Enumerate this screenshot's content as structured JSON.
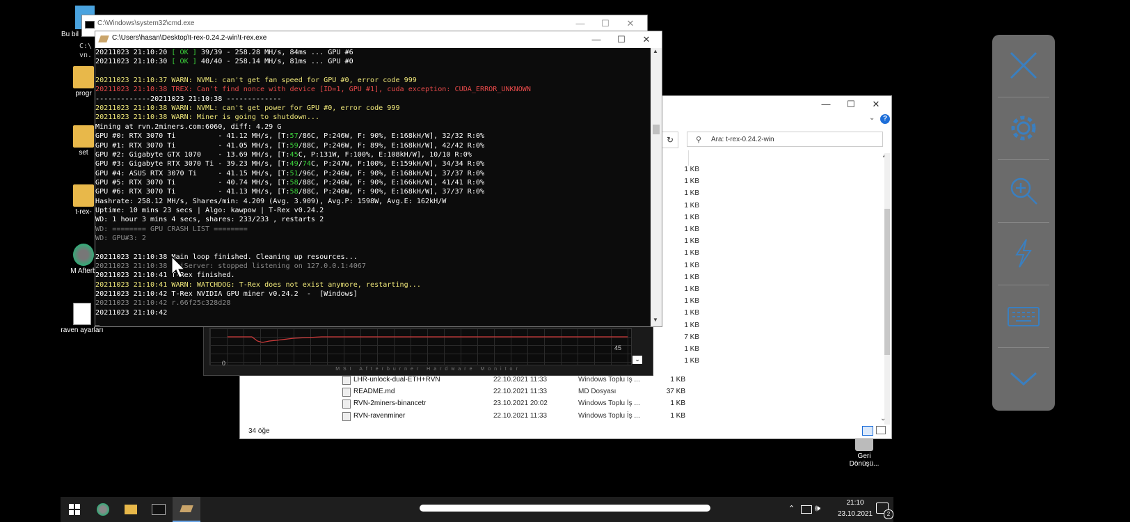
{
  "desktop": {
    "icons": [
      {
        "label": "Bu bil"
      },
      {
        "label": "progr"
      },
      {
        "label": "set"
      },
      {
        "label": "t-rex-"
      },
      {
        "label": "M Afterb"
      },
      {
        "label": "raven ayarları"
      },
      {
        "label": "Geri Dönüşü..."
      }
    ]
  },
  "cmd_window": {
    "title": "C:\\Windows\\system32\\cmd.exe",
    "partial_text": "C:\\ vn."
  },
  "trex_window": {
    "title": "C:\\Users\\hasan\\Desktop\\t-rex-0.24.2-win\\t-rex.exe",
    "lines": [
      [
        {
          "t": "20211023 21:10:20 ",
          "c": "w"
        },
        {
          "t": "[ OK ]",
          "c": "g"
        },
        {
          "t": " 39/39 - 258.28 MH/s, 84ms ... GPU #6",
          "c": "w"
        }
      ],
      [
        {
          "t": "20211023 21:10:30 ",
          "c": "w"
        },
        {
          "t": "[ OK ]",
          "c": "g"
        },
        {
          "t": " 40/40 - 258.14 MH/s, 81ms ... GPU #0",
          "c": "w"
        }
      ],
      [],
      [
        {
          "t": "20211023 21:10:37 WARN: NVML: can't get fan speed for GPU #0, error code 999",
          "c": "y"
        }
      ],
      [
        {
          "t": "20211023 21:10:38 TREX: Can't find nonce with device [ID=1, GPU #1], cuda exception: CUDA_ERROR_UNKNOWN",
          "c": "r"
        }
      ],
      [
        {
          "t": "-------------20211023 21:10:38 -------------",
          "c": "w"
        }
      ],
      [
        {
          "t": "20211023 21:10:38 WARN: NVML: can't get power for GPU #0, error code 999",
          "c": "y"
        }
      ],
      [
        {
          "t": "20211023 21:10:38 WARN: Miner is going to shutdown...",
          "c": "y"
        }
      ],
      [
        {
          "t": "Mining at rvn.2miners.com:6060, diff: 4.29 G",
          "c": "w"
        }
      ],
      [
        {
          "t": "GPU #0: RTX 3070 Ti          - 41.12 MH/s, [T:",
          "c": "w"
        },
        {
          "t": "57",
          "c": "g"
        },
        {
          "t": "/86C, P:246W, F: 90%, E:168kH/W], 32/32 R:0%",
          "c": "w"
        }
      ],
      [
        {
          "t": "GPU #1: RTX 3070 Ti          - 41.05 MH/s, [T:",
          "c": "w"
        },
        {
          "t": "59",
          "c": "g"
        },
        {
          "t": "/88C, P:246W, F: 89%, E:168kH/W], 42/42 R:0%",
          "c": "w"
        }
      ],
      [
        {
          "t": "GPU #2: Gigabyte GTX 1070    - 13.69 MH/s, [T:",
          "c": "w"
        },
        {
          "t": "45",
          "c": "g"
        },
        {
          "t": "C, P:131W, F:100%, E:108kH/W], 10/10 R:0%",
          "c": "w"
        }
      ],
      [
        {
          "t": "GPU #3: Gigabyte RTX 3070 Ti - 39.23 MH/s, [T:",
          "c": "w"
        },
        {
          "t": "49",
          "c": "g"
        },
        {
          "t": "/",
          "c": "w"
        },
        {
          "t": "74",
          "c": "g"
        },
        {
          "t": "C, P:247W, F:100%, E:159kH/W], 34/34 R:0%",
          "c": "w"
        }
      ],
      [
        {
          "t": "GPU #4: ASUS RTX 3070 Ti     - 41.15 MH/s, [T:",
          "c": "w"
        },
        {
          "t": "51",
          "c": "g"
        },
        {
          "t": "/96C, P:246W, F: 90%, E:168kH/W], 37/37 R:0%",
          "c": "w"
        }
      ],
      [
        {
          "t": "GPU #5: RTX 3070 Ti          - 40.74 MH/s, [T:",
          "c": "w"
        },
        {
          "t": "58",
          "c": "g"
        },
        {
          "t": "/88C, P:246W, F: 90%, E:166kH/W], 41/41 R:0%",
          "c": "w"
        }
      ],
      [
        {
          "t": "GPU #6: RTX 3070 Ti          - 41.13 MH/s, [T:",
          "c": "w"
        },
        {
          "t": "58",
          "c": "g"
        },
        {
          "t": "/88C, P:246W, F: 90%, E:168kH/W], 37/37 R:0%",
          "c": "w"
        }
      ],
      [
        {
          "t": "Hashrate: 258.12 MH/s, Shares/min: 4.209 (Avg. 3.909), Avg.P: 1598W, Avg.E: 162kH/W",
          "c": "w"
        }
      ],
      [
        {
          "t": "Uptime: 10 mins 23 secs | Algo: kawpow | T-Rex v0.24.2",
          "c": "w"
        }
      ],
      [
        {
          "t": "WD: 1 hour 3 mins 4 secs, shares: 233/233 , restarts 2",
          "c": "w"
        }
      ],
      [
        {
          "t": "WD: ======== GPU CRASH LIST ========",
          "c": "gr"
        }
      ],
      [
        {
          "t": "WD: GPU#3: 2",
          "c": "gr"
        }
      ],
      [],
      [
        {
          "t": "20211023 21:10:38 Main loop finished. Cleaning up resources...",
          "c": "w"
        }
      ],
      [
        {
          "t": "20211023 21:10:38 ApiServer: stopped listening on 127.0.0.1:4067",
          "c": "gr"
        }
      ],
      [
        {
          "t": "20211023 21:10:41 T-Rex finished.",
          "c": "w"
        }
      ],
      [
        {
          "t": "20211023 21:10:41 WARN: WATCHDOG: T-Rex does not exist anymore, restarting...",
          "c": "y"
        }
      ],
      [
        {
          "t": "20211023 21:10:42 T-Rex NVIDIA GPU miner v0.24.2  -  [Windows]",
          "c": "w"
        }
      ],
      [
        {
          "t": "20211023 21:10:42 r.66f25c328d28",
          "c": "gr"
        }
      ],
      [
        {
          "t": "20211023 21:10:42",
          "c": "w"
        }
      ],
      [
        {
          "t": "_",
          "c": "w"
        }
      ]
    ]
  },
  "explorer": {
    "search_placeholder": "Ara: t-rex-0.24.2-win",
    "column_fragment": "t",
    "size_column": [
      "1 KB",
      "1 KB",
      "1 KB",
      "1 KB",
      "1 KB",
      "1 KB",
      "1 KB",
      "1 KB",
      "1 KB",
      "1 KB",
      "1 KB",
      "1 KB",
      "1 KB",
      "1 KB",
      "7 KB",
      "1 KB",
      "1 KB"
    ],
    "files": [
      {
        "name": "LHR-unlock-dual-ETH+RVN",
        "date": "22.10.2021 11:33",
        "type": "Windows Toplu İş ...",
        "size": "1 KB"
      },
      {
        "name": "README.md",
        "date": "22.10.2021 11:33",
        "type": "MD Dosyası",
        "size": "37 KB"
      },
      {
        "name": "RVN-2miners-binancetr",
        "date": "23.10.2021 20:02",
        "type": "Windows Toplu İş ...",
        "size": "1 KB"
      },
      {
        "name": "RVN-ravenminer",
        "date": "22.10.2021 11:33",
        "type": "Windows Toplu İş ...",
        "size": "1 KB"
      }
    ],
    "status": "34 öğe",
    "help": "?"
  },
  "afterburner": {
    "footer": "MSI Afterburner Hardware Monitor",
    "value_right": "45",
    "value_left": "0"
  },
  "taskbar": {
    "time": "21:10",
    "date": "23.10.2021",
    "notification_count": "2"
  }
}
